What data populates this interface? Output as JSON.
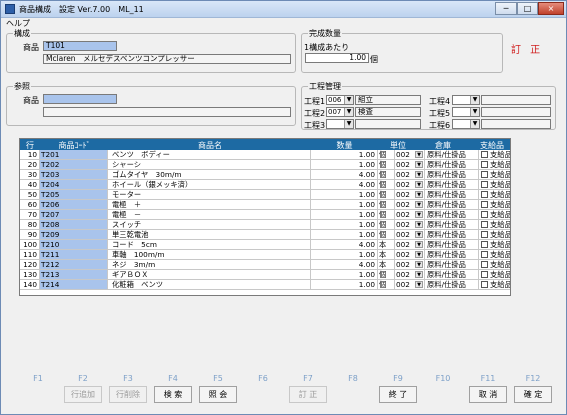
{
  "window": {
    "title": "商品構成　設定 Ver.7.00　ML_11",
    "min": "─",
    "max": "□",
    "close": "×"
  },
  "menu": {
    "help": "ヘルプ"
  },
  "kousei": {
    "legend": "構成",
    "product_label": "商品",
    "product_code": "T101",
    "product_name": "Mclaren　メルセデスベンツコンプレッサー"
  },
  "kansei": {
    "legend": "完成数量",
    "per_label": "1構成あたり",
    "qty": "1.00",
    "unit": "個"
  },
  "status_mark": "訂 正",
  "sanshou": {
    "legend": "参照",
    "product_label": "商品",
    "code": "",
    "name": ""
  },
  "kouteikanri": {
    "legend": "工程管理",
    "processes": [
      {
        "label": "工程1",
        "code": "006",
        "name": "組立"
      },
      {
        "label": "工程2",
        "code": "007",
        "name": "検査"
      },
      {
        "label": "工程3",
        "code": "",
        "name": ""
      },
      {
        "label": "工程4",
        "code": "",
        "name": ""
      },
      {
        "label": "工程5",
        "code": "",
        "name": ""
      },
      {
        "label": "工程6",
        "code": "",
        "name": ""
      }
    ]
  },
  "grid": {
    "headers": {
      "gyo": "行",
      "code": "商品ｺｰﾄﾞ",
      "name": "商品名",
      "qty": "数量",
      "unit": "単位",
      "warehouse": "倉庫",
      "supplies": "支給品"
    },
    "rows": [
      {
        "gyo": "10",
        "code": "T201",
        "name": "ベンツ　ボディー",
        "qty": "1.00",
        "unit": "個",
        "wh_code": "002",
        "wh_name": "原料/仕掛品",
        "chk": "支給品"
      },
      {
        "gyo": "20",
        "code": "T202",
        "name": "シャーシ",
        "qty": "1.00",
        "unit": "個",
        "wh_code": "002",
        "wh_name": "原料/仕掛品",
        "chk": "支給品"
      },
      {
        "gyo": "30",
        "code": "T203",
        "name": "ゴムタイヤ　30m/m",
        "qty": "4.00",
        "unit": "個",
        "wh_code": "002",
        "wh_name": "原料/仕掛品",
        "chk": "支給品"
      },
      {
        "gyo": "40",
        "code": "T204",
        "name": "ホイール（銀メッキ済）",
        "qty": "4.00",
        "unit": "個",
        "wh_code": "002",
        "wh_name": "原料/仕掛品",
        "chk": "支給品"
      },
      {
        "gyo": "50",
        "code": "T205",
        "name": "モーター",
        "qty": "1.00",
        "unit": "個",
        "wh_code": "002",
        "wh_name": "原料/仕掛品",
        "chk": "支給品"
      },
      {
        "gyo": "60",
        "code": "T206",
        "name": "電極　＋",
        "qty": "1.00",
        "unit": "個",
        "wh_code": "002",
        "wh_name": "原料/仕掛品",
        "chk": "支給品"
      },
      {
        "gyo": "70",
        "code": "T207",
        "name": "電極　－",
        "qty": "1.00",
        "unit": "個",
        "wh_code": "002",
        "wh_name": "原料/仕掛品",
        "chk": "支給品"
      },
      {
        "gyo": "80",
        "code": "T208",
        "name": "スイッチ",
        "qty": "1.00",
        "unit": "個",
        "wh_code": "002",
        "wh_name": "原料/仕掛品",
        "chk": "支給品"
      },
      {
        "gyo": "90",
        "code": "T209",
        "name": "単三乾電池",
        "qty": "1.00",
        "unit": "個",
        "wh_code": "002",
        "wh_name": "原料/仕掛品",
        "chk": "支給品"
      },
      {
        "gyo": "100",
        "code": "T210",
        "name": "コード　5cm",
        "qty": "4.00",
        "unit": "本",
        "wh_code": "002",
        "wh_name": "原料/仕掛品",
        "chk": "支給品"
      },
      {
        "gyo": "110",
        "code": "T211",
        "name": "車軸　100m/m",
        "qty": "1.00",
        "unit": "本",
        "wh_code": "002",
        "wh_name": "原料/仕掛品",
        "chk": "支給品"
      },
      {
        "gyo": "120",
        "code": "T212",
        "name": "ネジ　3m/m",
        "qty": "4.00",
        "unit": "本",
        "wh_code": "002",
        "wh_name": "原料/仕掛品",
        "chk": "支給品"
      },
      {
        "gyo": "130",
        "code": "T213",
        "name": "ギアＢＯＸ",
        "qty": "1.00",
        "unit": "個",
        "wh_code": "002",
        "wh_name": "原料/仕掛品",
        "chk": "支給品"
      },
      {
        "gyo": "140",
        "code": "T214",
        "name": "化粧箱　ベンツ",
        "qty": "1.00",
        "unit": "個",
        "wh_code": "002",
        "wh_name": "原料/仕掛品",
        "chk": "支給品"
      }
    ]
  },
  "fkeys": [
    {
      "key": "F1",
      "label": "",
      "state": "none"
    },
    {
      "key": "F2",
      "label": "行追加",
      "state": "off"
    },
    {
      "key": "F3",
      "label": "行削除",
      "state": "off"
    },
    {
      "key": "F4",
      "label": "検 索",
      "state": "on"
    },
    {
      "key": "F5",
      "label": "照 会",
      "state": "on"
    },
    {
      "key": "F6",
      "label": "",
      "state": "none"
    },
    {
      "key": "F7",
      "label": "訂 正",
      "state": "off"
    },
    {
      "key": "F8",
      "label": "",
      "state": "none"
    },
    {
      "key": "F9",
      "label": "終 了",
      "state": "on"
    },
    {
      "key": "F10",
      "label": "",
      "state": "none"
    },
    {
      "key": "F11",
      "label": "取 消",
      "state": "on"
    },
    {
      "key": "F12",
      "label": "確 定",
      "state": "on"
    }
  ]
}
